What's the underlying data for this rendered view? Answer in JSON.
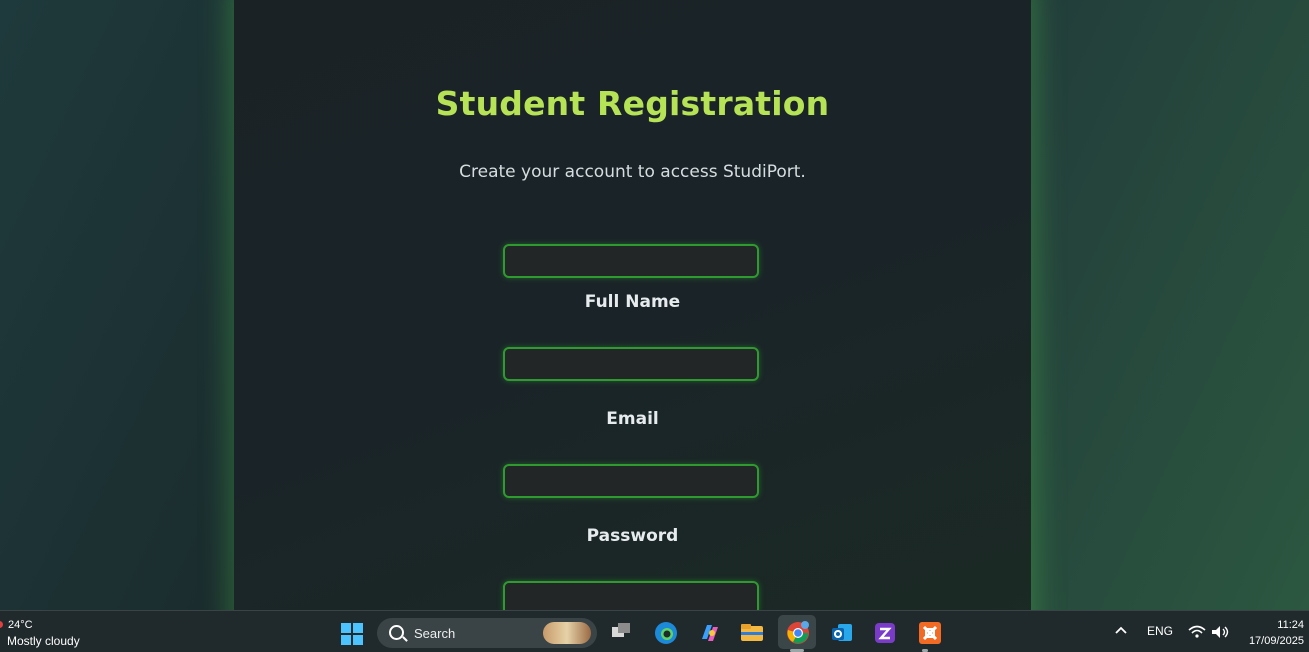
{
  "form": {
    "title": "Student Registration",
    "subtitle": "Create your account to access StudiPort.",
    "fields": [
      {
        "label": "Full Name",
        "value": ""
      },
      {
        "label": "Email",
        "value": ""
      },
      {
        "label": "Password",
        "value": ""
      },
      {
        "label": "",
        "value": ""
      }
    ]
  },
  "taskbar": {
    "weather_temp": "24°C",
    "weather_desc": "Mostly cloudy",
    "search_label": "Search",
    "language": "ENG",
    "time": "11:24",
    "date": "17/09/2025",
    "icons": [
      "windows-start-icon",
      "search-icon",
      "task-view-icon",
      "edge-icon",
      "copilot-icon",
      "file-explorer-icon",
      "chrome-icon",
      "outlook-icon",
      "visual-studio-icon",
      "xampp-icon",
      "chevron-up-icon",
      "wifi-icon",
      "volume-icon"
    ]
  },
  "colors": {
    "title": "#b6e356",
    "field_border": "#2f9a2f",
    "card_glow": "#50c850"
  }
}
